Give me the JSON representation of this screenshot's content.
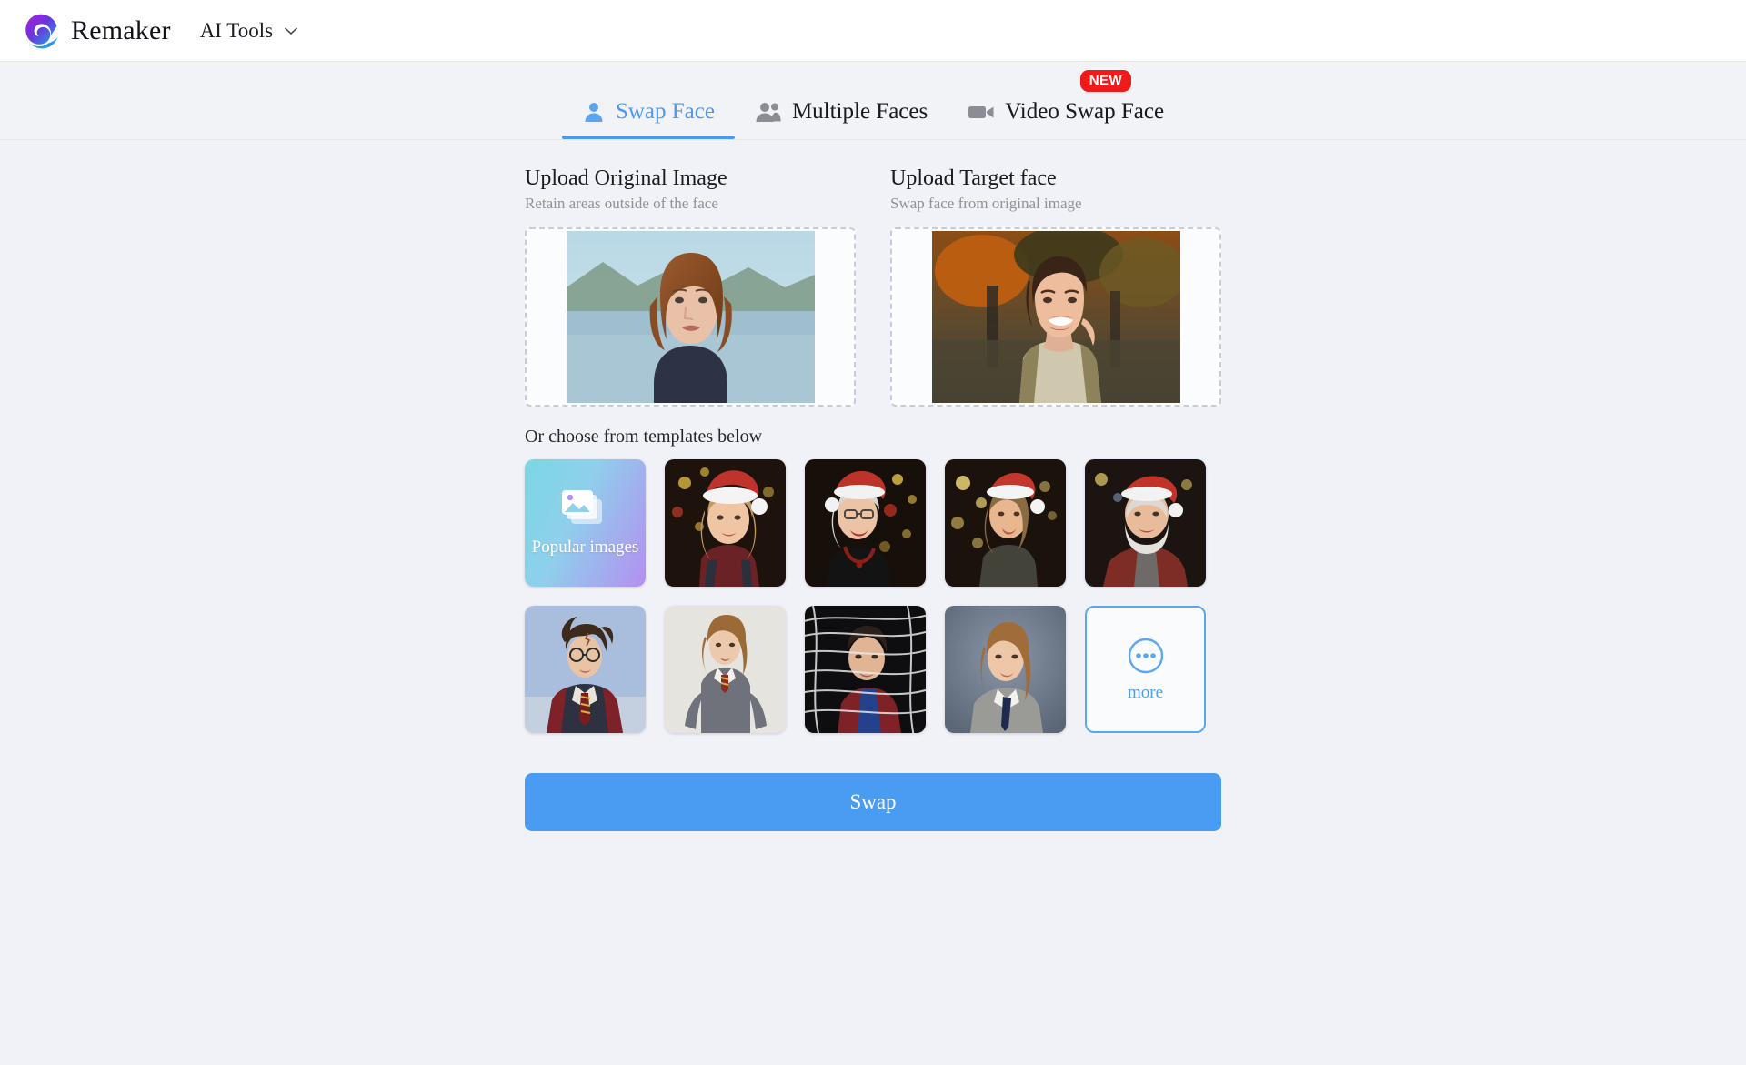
{
  "header": {
    "brand": "Remaker",
    "logo_icon": "swirl-logo-icon",
    "nav": {
      "label": "AI Tools",
      "chevron_icon": "chevron-down-icon"
    }
  },
  "tabs": [
    {
      "label": "Swap Face",
      "icon": "person-icon",
      "active": true,
      "badge": ""
    },
    {
      "label": "Multiple Faces",
      "icon": "people-icon",
      "active": false,
      "badge": ""
    },
    {
      "label": "Video Swap Face",
      "icon": "video-camera-icon",
      "active": false,
      "badge": "NEW"
    }
  ],
  "uploads": [
    {
      "title": "Upload Original Image",
      "subtitle": "Retain areas outside of the face",
      "image_alt": "woman-with-auburn-bob-at-lake"
    },
    {
      "title": "Upload Target face",
      "subtitle": "Swap face from original image",
      "image_alt": "smiling-woman-autumn-tweed-coat"
    }
  ],
  "templates": {
    "label": "Or choose from templates below",
    "popular": {
      "label": "Popular images",
      "icon": "stacked-images-icon"
    },
    "items": [
      {
        "alt": "girl-in-santa-hat-christmas-tree"
      },
      {
        "alt": "older-woman-santa-hat-glasses-red-beads"
      },
      {
        "alt": "woman-santa-hat-bokeh-tree"
      },
      {
        "alt": "bearded-man-santa-hat-red-sweater"
      },
      {
        "alt": "boy-wizard-school-robes"
      },
      {
        "alt": "girl-wizard-grey-sweater-tie"
      },
      {
        "alt": "young-man-in-webs-red-blue-suit"
      },
      {
        "alt": "girl-school-portrait-grey-blazer"
      }
    ],
    "more": {
      "label": "more",
      "icon": "more-dots-circle-icon"
    }
  },
  "actions": {
    "swap_label": "Swap"
  },
  "colors": {
    "accent": "#4a9cf3",
    "badge": "#ef1b1b",
    "page_bg": "#f1f2f7",
    "header_bg": "#ffffff"
  }
}
